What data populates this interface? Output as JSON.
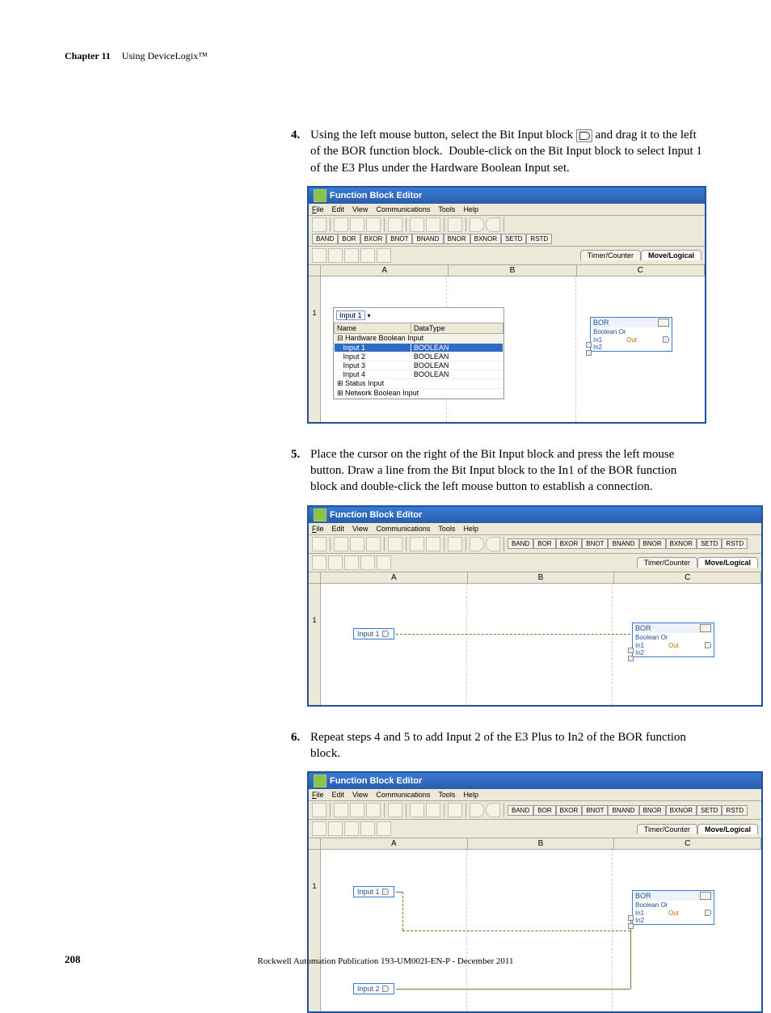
{
  "header": {
    "chapter": "Chapter 11",
    "title": "Using DeviceLogix™"
  },
  "steps": {
    "s4": "Using the left mouse button, select the Bit Input block  and drag it to the left of the BOR function block.  Double-click on the Bit Input block to select Input 1 of the E3 Plus under the Hardware Boolean Input set.",
    "s5": "Place the cursor on the right of the Bit Input block and press the left mouse button.  Draw a line from the Bit Input block to the In1 of the BOR function block and double-click the left mouse button to establish a connection.",
    "s6": "Repeat steps 4 and 5 to add Input 2 of the E3 Plus to In2 of the BOR function block."
  },
  "window": {
    "title": "Function Block Editor",
    "menus": [
      "File",
      "Edit",
      "View",
      "Communications",
      "Tools",
      "Help"
    ],
    "palette": [
      "BAND",
      "BOR",
      "BXOR",
      "BNOT",
      "BNAND",
      "BNOR",
      "BXNOR",
      "SETD",
      "RSTD"
    ],
    "tabs": [
      "Timer/Counter",
      "Move/Logical"
    ],
    "cols": [
      "A",
      "B",
      "C"
    ],
    "row": "1"
  },
  "tree": {
    "selected": "Input 1",
    "nameHdr": "Name",
    "typeHdr": "DataType",
    "group": "Hardware Boolean Input",
    "rows": [
      {
        "n": "Input 1",
        "t": "BOOLEAN",
        "sel": true
      },
      {
        "n": "Input 2",
        "t": "BOOLEAN"
      },
      {
        "n": "Input 3",
        "t": "BOOLEAN"
      },
      {
        "n": "Input 4",
        "t": "BOOLEAN"
      }
    ],
    "extra1": "Status Input",
    "extra2": "Network Boolean Input"
  },
  "bor": {
    "title": "BOR",
    "sub": "Boolean Or",
    "in1": "In1",
    "in2": "In2",
    "out": "Out"
  },
  "inputs": {
    "i1": "Input 1",
    "i2": "Input 2"
  },
  "footer": "Rockwell Automation Publication 193-UM002I-EN-P - December 2011",
  "pagenum": "208"
}
